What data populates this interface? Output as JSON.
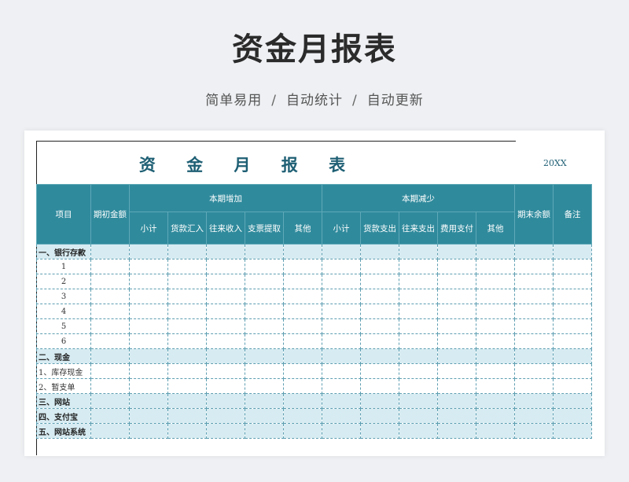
{
  "header": {
    "title": "资金月报表",
    "tagline": [
      "简单易用",
      "自动统计",
      "自动更新"
    ],
    "separator": "/"
  },
  "sheet": {
    "title": "资 金 月 报 表",
    "year": "20XX",
    "columns": {
      "item": "项目",
      "opening": "期初金额",
      "increase_group": "本期增加",
      "increase": [
        "小计",
        "货款汇入",
        "往来收入",
        "支票提取",
        "其他"
      ],
      "decrease_group": "本期减少",
      "decrease": [
        "小计",
        "货款支出",
        "往来支出",
        "费用支付",
        "其他"
      ],
      "closing": "期末余额",
      "note": "备注"
    },
    "rows": [
      {
        "label": "一、银行存款",
        "type": "cat"
      },
      {
        "label": "1",
        "type": "sub"
      },
      {
        "label": "2",
        "type": "sub"
      },
      {
        "label": "3",
        "type": "sub"
      },
      {
        "label": "4",
        "type": "sub"
      },
      {
        "label": "5",
        "type": "sub"
      },
      {
        "label": "6",
        "type": "sub"
      },
      {
        "label": "二、现金",
        "type": "cat"
      },
      {
        "label": "1、库存现金",
        "type": "sub2"
      },
      {
        "label": "2、暂支单",
        "type": "sub2"
      },
      {
        "label": "三、网站",
        "type": "cat"
      },
      {
        "label": "四、支付宝",
        "type": "cat"
      },
      {
        "label": "五、网站系统",
        "type": "cat"
      }
    ]
  }
}
